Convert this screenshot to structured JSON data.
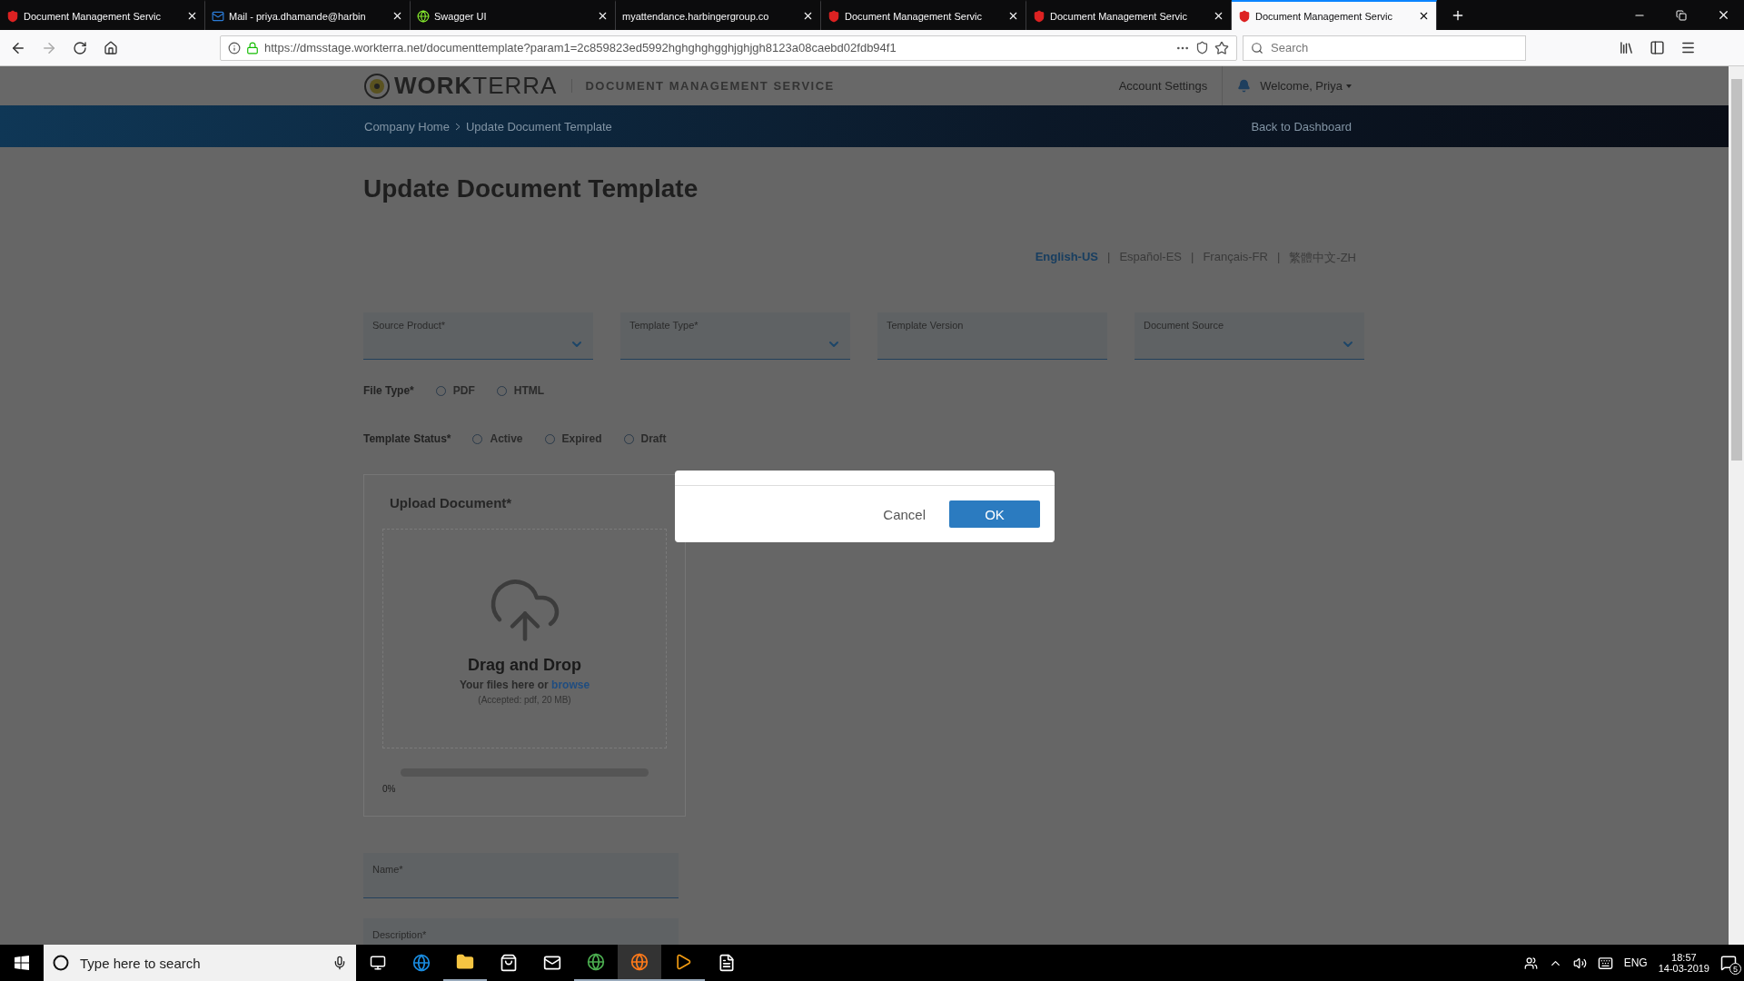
{
  "browser": {
    "tabs": [
      {
        "title": "Document Management Servic",
        "kind": "app",
        "selected": false
      },
      {
        "title": "Mail - priya.dhamande@harbin",
        "kind": "mail",
        "selected": false
      },
      {
        "title": "Swagger UI",
        "kind": "swagger",
        "selected": false
      },
      {
        "title": "myattendance.harbingergroup.co",
        "kind": "none",
        "selected": false
      },
      {
        "title": "Document Management Servic",
        "kind": "app",
        "selected": false
      },
      {
        "title": "Document Management Servic",
        "kind": "app",
        "selected": false
      },
      {
        "title": "Document Management Servic",
        "kind": "app",
        "selected": true
      }
    ],
    "url": "https://dmsstage.workterra.net/documenttemplate?param1=2c859823ed5992hghghghgghjghjgh8123a08caebd02fdb94f1",
    "search": {
      "placeholder": "Search"
    }
  },
  "header": {
    "logo": "**WORK**TERRA",
    "service": "DOCUMENT MANAGEMENT SERVICE",
    "account": "Account Settings",
    "welcome": "Welcome, Priya"
  },
  "breadcrumb": {
    "items": [
      "Company Home",
      "Update Document Template"
    ],
    "back": "Back to Dashboard"
  },
  "title": "Update Document Template",
  "language_separators": [
    "|",
    "|",
    "|"
  ],
  "languages": [
    {
      "label": "English-US",
      "selected": true
    },
    {
      "label": "Español-ES",
      "selected": false
    },
    {
      "label": "Français-FR",
      "selected": false
    },
    {
      "label": "繁體中文-ZH",
      "selected": false
    }
  ],
  "fields": [
    {
      "label": "Source Product*",
      "kind": "select"
    },
    {
      "label": "Template Type*",
      "kind": "select"
    },
    {
      "label": "Template Version",
      "kind": "text"
    },
    {
      "label": "Document Source",
      "kind": "select"
    }
  ],
  "radio_groups": [
    {
      "label": "File Type*",
      "options": [
        {
          "label": "PDF",
          "selected": false
        },
        {
          "label": "HTML",
          "selected": false
        }
      ]
    },
    {
      "label": "Template Status*",
      "options": [
        {
          "label": "Active",
          "selected": false
        },
        {
          "label": "Expired",
          "selected": false
        },
        {
          "label": "Draft",
          "selected": false
        }
      ]
    }
  ],
  "upload": {
    "title": "Upload Document*",
    "drop_title": "Drag and Drop",
    "hint": "Your files here or",
    "link": "browse",
    "accepted": "(Accepted: pdf, 20 MB)",
    "level": 0,
    "reading": "0%"
  },
  "name_field": {
    "label": "Name*"
  },
  "description_field": {
    "label": "Description*"
  },
  "dialog": {
    "buttons": [
      {
        "label": "Cancel",
        "kind": "plain"
      },
      {
        "label": "OK",
        "kind": "primary"
      }
    ]
  },
  "taskbar": {
    "search": {
      "placeholder": "Type here to search"
    },
    "language": "ENG",
    "time": "18:57",
    "date": "14-03-2019",
    "notifications": "5"
  }
}
